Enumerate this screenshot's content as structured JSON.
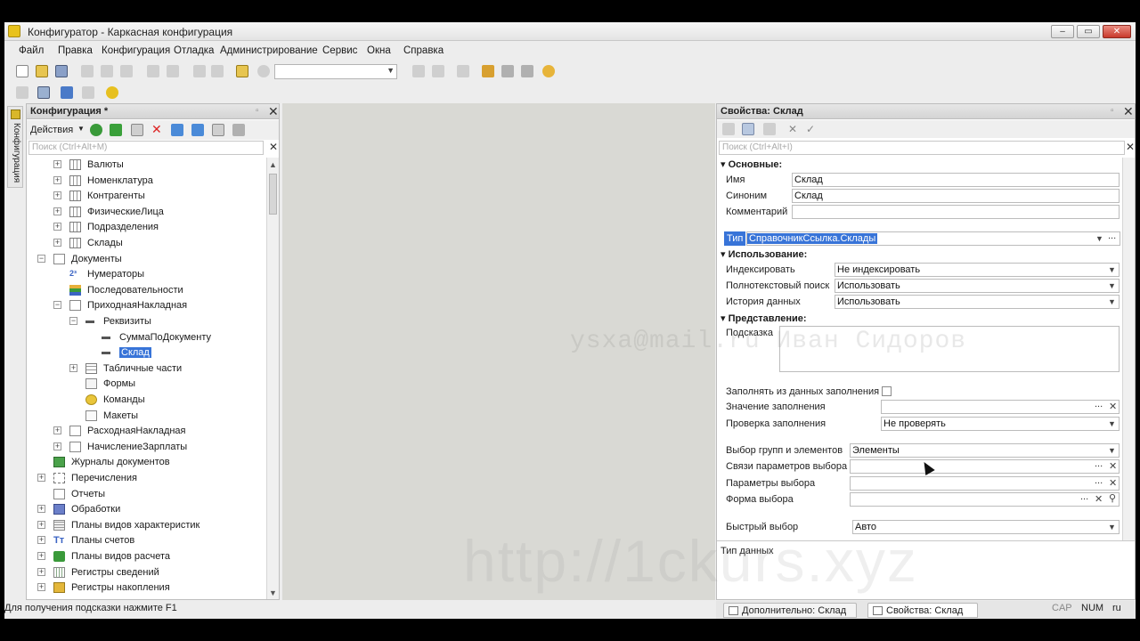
{
  "window": {
    "title": "Конфигуратор - Каркасная конфигурация",
    "buttons": {
      "minimize": "–",
      "maximize": "▭",
      "close": "✕"
    }
  },
  "menu": [
    "Файл",
    "Правка",
    "Конфигурация",
    "Отладка",
    "Администрирование",
    "Сервис",
    "Окна",
    "Справка"
  ],
  "side_strip": {
    "label": "Конфигурация"
  },
  "config_panel": {
    "title": "Конфигурация *",
    "actions_label": "Действия",
    "search_placeholder": "Поиск (Ctrl+Alt+M)",
    "tree": [
      {
        "label": "Валюты",
        "icon": "catalog-icon",
        "level": 1,
        "expander": "+"
      },
      {
        "label": "Номенклатура",
        "icon": "catalog-icon",
        "level": 1,
        "expander": "+"
      },
      {
        "label": "Контрагенты",
        "icon": "catalog-icon",
        "level": 1,
        "expander": "+"
      },
      {
        "label": "ФизическиеЛица",
        "icon": "catalog-icon",
        "level": 1,
        "expander": "+"
      },
      {
        "label": "Подразделения",
        "icon": "catalog-icon",
        "level": 1,
        "expander": "+"
      },
      {
        "label": "Склады",
        "icon": "catalog-icon",
        "level": 1,
        "expander": "+"
      },
      {
        "label": "Документы",
        "icon": "documents-icon",
        "level": 0,
        "expander": "−"
      },
      {
        "label": "Нумераторы",
        "icon": "numerator-icon",
        "level": 1,
        "expander": ""
      },
      {
        "label": "Последовательности",
        "icon": "sequence-icon",
        "level": 1,
        "expander": ""
      },
      {
        "label": "ПриходнаяНакладная",
        "icon": "document-icon",
        "level": 1,
        "expander": "−"
      },
      {
        "label": "Реквизиты",
        "icon": "attribute-icon",
        "level": 2,
        "expander": "−"
      },
      {
        "label": "СуммаПоДокументу",
        "icon": "attribute-icon",
        "level": 3,
        "expander": ""
      },
      {
        "label": "Склад",
        "icon": "attribute-icon",
        "level": 3,
        "expander": "",
        "selected": true
      },
      {
        "label": "Табличные части",
        "icon": "table-icon",
        "level": 2,
        "expander": "+"
      },
      {
        "label": "Формы",
        "icon": "form-icon",
        "level": 2,
        "expander": ""
      },
      {
        "label": "Команды",
        "icon": "command-icon",
        "level": 2,
        "expander": ""
      },
      {
        "label": "Макеты",
        "icon": "template-icon",
        "level": 2,
        "expander": ""
      },
      {
        "label": "РасходнаяНакладная",
        "icon": "document-icon",
        "level": 1,
        "expander": "+"
      },
      {
        "label": "НачислениеЗарплаты",
        "icon": "document-icon",
        "level": 1,
        "expander": "+"
      },
      {
        "label": "Журналы документов",
        "icon": "journal-icon",
        "level": 0,
        "expander": ""
      },
      {
        "label": "Перечисления",
        "icon": "enum-icon",
        "level": 0,
        "expander": "+"
      },
      {
        "label": "Отчеты",
        "icon": "report-icon",
        "level": 0,
        "expander": ""
      },
      {
        "label": "Обработки",
        "icon": "processing-icon",
        "level": 0,
        "expander": "+"
      },
      {
        "label": "Планы видов характеристик",
        "icon": "chart-of-characteristics-icon",
        "level": 0,
        "expander": "+"
      },
      {
        "label": "Планы счетов",
        "icon": "chart-of-accounts-icon",
        "level": 0,
        "expander": "+"
      },
      {
        "label": "Планы видов расчета",
        "icon": "calculation-types-icon",
        "level": 0,
        "expander": "+"
      },
      {
        "label": "Регистры сведений",
        "icon": "information-register-icon",
        "level": 0,
        "expander": "+"
      },
      {
        "label": "Регистры накопления",
        "icon": "accumulation-register-icon",
        "level": 0,
        "expander": "+"
      }
    ]
  },
  "props_panel": {
    "title": "Свойства: Склад",
    "search_placeholder": "Поиск (Ctrl+Alt+I)",
    "sections": {
      "main": "Основные:",
      "usage": "Использование:",
      "presentation": "Представление:"
    },
    "name_label": "Имя",
    "name_value": "Склад",
    "synonym_label": "Синоним",
    "synonym_value": "Склад",
    "comment_label": "Комментарий",
    "comment_value": "",
    "type_label": "Тип",
    "type_value": "СправочникСсылка.Склады",
    "index_label": "Индексировать",
    "index_value": "Не индексировать",
    "fulltext_label": "Полнотекстовый поиск",
    "fulltext_value": "Использовать",
    "history_label": "История данных",
    "history_value": "Использовать",
    "hint_label": "Подсказка",
    "fill_from_label": "Заполнять из данных заполнения",
    "fill_value_label": "Значение заполнения",
    "fill_check_label": "Проверка заполнения",
    "fill_check_value": "Не проверять",
    "group_choice_label": "Выбор групп и элементов",
    "group_choice_value": "Элементы",
    "param_links_label": "Связи параметров выбора",
    "param_choice_label": "Параметры выбора",
    "choice_form_label": "Форма выбора",
    "quick_choice_label": "Быстрый выбор",
    "quick_choice_value": "Авто",
    "type_data_label": "Тип данных"
  },
  "bottom_tabs": [
    "Дополнительно: Склад",
    "Свойства: Склад"
  ],
  "status": {
    "message": "Для получения подсказки нажмите F1",
    "cap": "CAP",
    "num": "NUM",
    "lang": "ru"
  },
  "watermarks": {
    "email": "ysxa@mail.ru Иван Сидоров",
    "site": "http://1ckurs.xyz"
  }
}
